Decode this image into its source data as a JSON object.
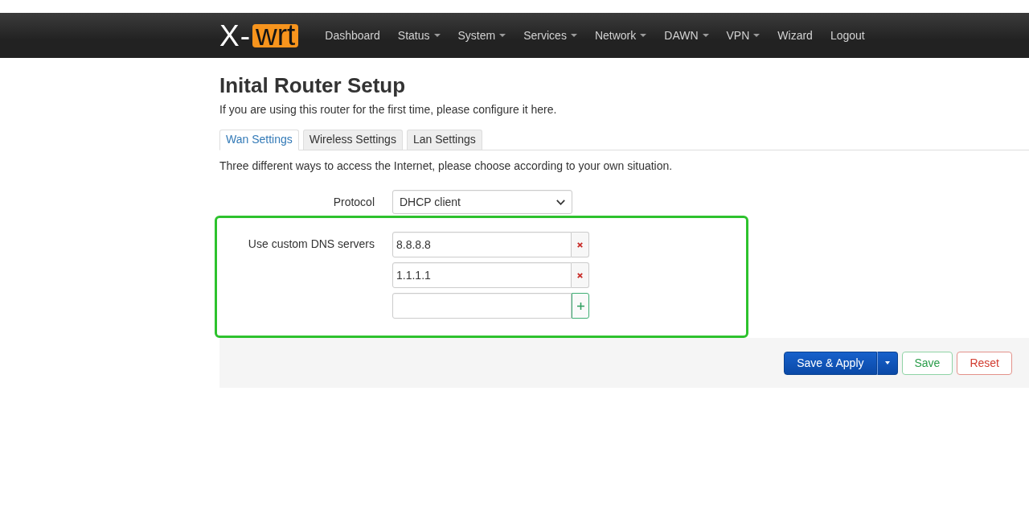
{
  "navbar": {
    "logo": {
      "prefix": "X-",
      "highlight": "wrt"
    },
    "menu": [
      {
        "label": "Dashboard",
        "dropdown": false
      },
      {
        "label": "Status",
        "dropdown": true
      },
      {
        "label": "System",
        "dropdown": true
      },
      {
        "label": "Services",
        "dropdown": true
      },
      {
        "label": "Network",
        "dropdown": true
      },
      {
        "label": "DAWN",
        "dropdown": true
      },
      {
        "label": "VPN",
        "dropdown": true
      },
      {
        "label": "Wizard",
        "dropdown": false
      },
      {
        "label": "Logout",
        "dropdown": false
      }
    ]
  },
  "page": {
    "title": "Inital Router Setup",
    "subtitle": "If you are using this router for the first time, please configure it here."
  },
  "tabs": [
    {
      "label": "Wan Settings",
      "selected": true
    },
    {
      "label": "Wireless Settings",
      "selected": false
    },
    {
      "label": "Lan Settings",
      "selected": false
    }
  ],
  "wan": {
    "description": "Three different ways to access the Internet, please choose according to your own situation.",
    "protocol": {
      "label": "Protocol",
      "value": "DHCP client"
    },
    "dns": {
      "label": "Use custom DNS servers",
      "highlighted": true,
      "entries": [
        {
          "kind": "value",
          "value": "8.8.8.8"
        },
        {
          "kind": "value",
          "value": "1.1.1.1"
        },
        {
          "kind": "new"
        }
      ]
    }
  },
  "actions": [
    {
      "label": "Save & Apply",
      "kind": "primary",
      "dropdown": true
    },
    {
      "label": "Save",
      "kind": "save",
      "dropdown": false
    },
    {
      "label": "Reset",
      "kind": "reset",
      "dropdown": false
    }
  ]
}
